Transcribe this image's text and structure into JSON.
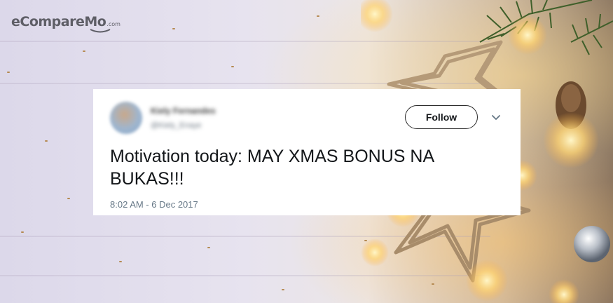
{
  "logo": {
    "text": "eCompareMo",
    "tld": ".com"
  },
  "tweet": {
    "user_name": "Kiely Fernandes",
    "user_handle": "@Kiely_Enaye",
    "follow_label": "Follow",
    "text": "Motivation today: MAY XMAS BONUS NA BUKAS!!!",
    "timestamp": "8:02 AM - 6 Dec 2017"
  },
  "icons": {
    "more": "chevron-down-icon"
  },
  "colors": {
    "card_bg": "#ffffff",
    "text": "#14171a",
    "meta": "#657786"
  }
}
